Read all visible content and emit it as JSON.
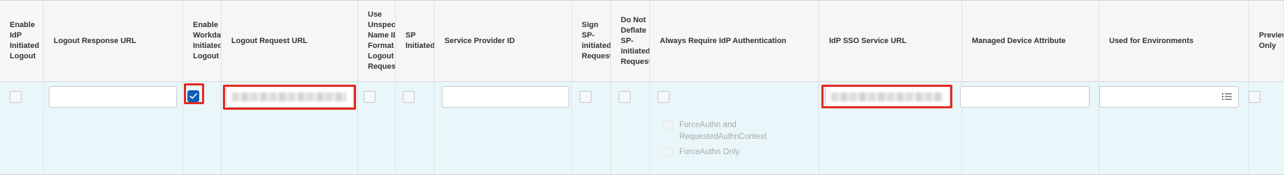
{
  "columns": [
    {
      "key": "enable_idp_logout",
      "label": "Enable\nIdP\nInitiated\nLogout"
    },
    {
      "key": "logout_response_url",
      "label": "Logout Response URL"
    },
    {
      "key": "enable_workday_logout",
      "label": "Enable\nWorkday\nInitiated\nLogout"
    },
    {
      "key": "logout_request_url",
      "label": "Logout Request URL"
    },
    {
      "key": "use_unspecified_name_id",
      "label": "Use\nUnspecifie\nName ID\nFormat for\nLogout\nRequest"
    },
    {
      "key": "sp_initiated",
      "label": "SP\nInitiated"
    },
    {
      "key": "service_provider_id",
      "label": "Service Provider ID"
    },
    {
      "key": "sign_sp_request",
      "label": "Sign SP-\ninitiated\nRequest"
    },
    {
      "key": "do_not_deflate",
      "label": "Do Not\nDeflate\nSP-\ninitiated\nRequest"
    },
    {
      "key": "always_require_idp_auth",
      "label": "Always Require IdP Authentication"
    },
    {
      "key": "idp_sso_service_url",
      "label": "IdP SSO Service URL"
    },
    {
      "key": "managed_device_attribute",
      "label": "Managed Device Attribute"
    },
    {
      "key": "used_for_environments",
      "label": "Used for Environments"
    },
    {
      "key": "preview_only",
      "label": "Preview\nOnly"
    }
  ],
  "row": {
    "enable_idp_logout": false,
    "logout_response_url": "",
    "enable_workday_logout": true,
    "logout_request_url": "",
    "use_unspecified_name_id": false,
    "sp_initiated": false,
    "service_provider_id": "",
    "sign_sp_request": false,
    "do_not_deflate": false,
    "always_require_idp_auth": false,
    "auth_options": [
      "ForceAuthn and\nRequestedAuthnContext",
      "ForceAuthn Only"
    ],
    "idp_sso_service_url": "",
    "managed_device_attribute": "",
    "used_for_environments": "",
    "preview_only": false
  },
  "icons": {
    "checkmark": "check-icon",
    "prompt": "prompt-list-icon"
  },
  "colors": {
    "highlight": "#e3271d",
    "checked": "#0b5db4",
    "row_background": "#e9f6fa",
    "header_background": "#f6f6f6"
  }
}
